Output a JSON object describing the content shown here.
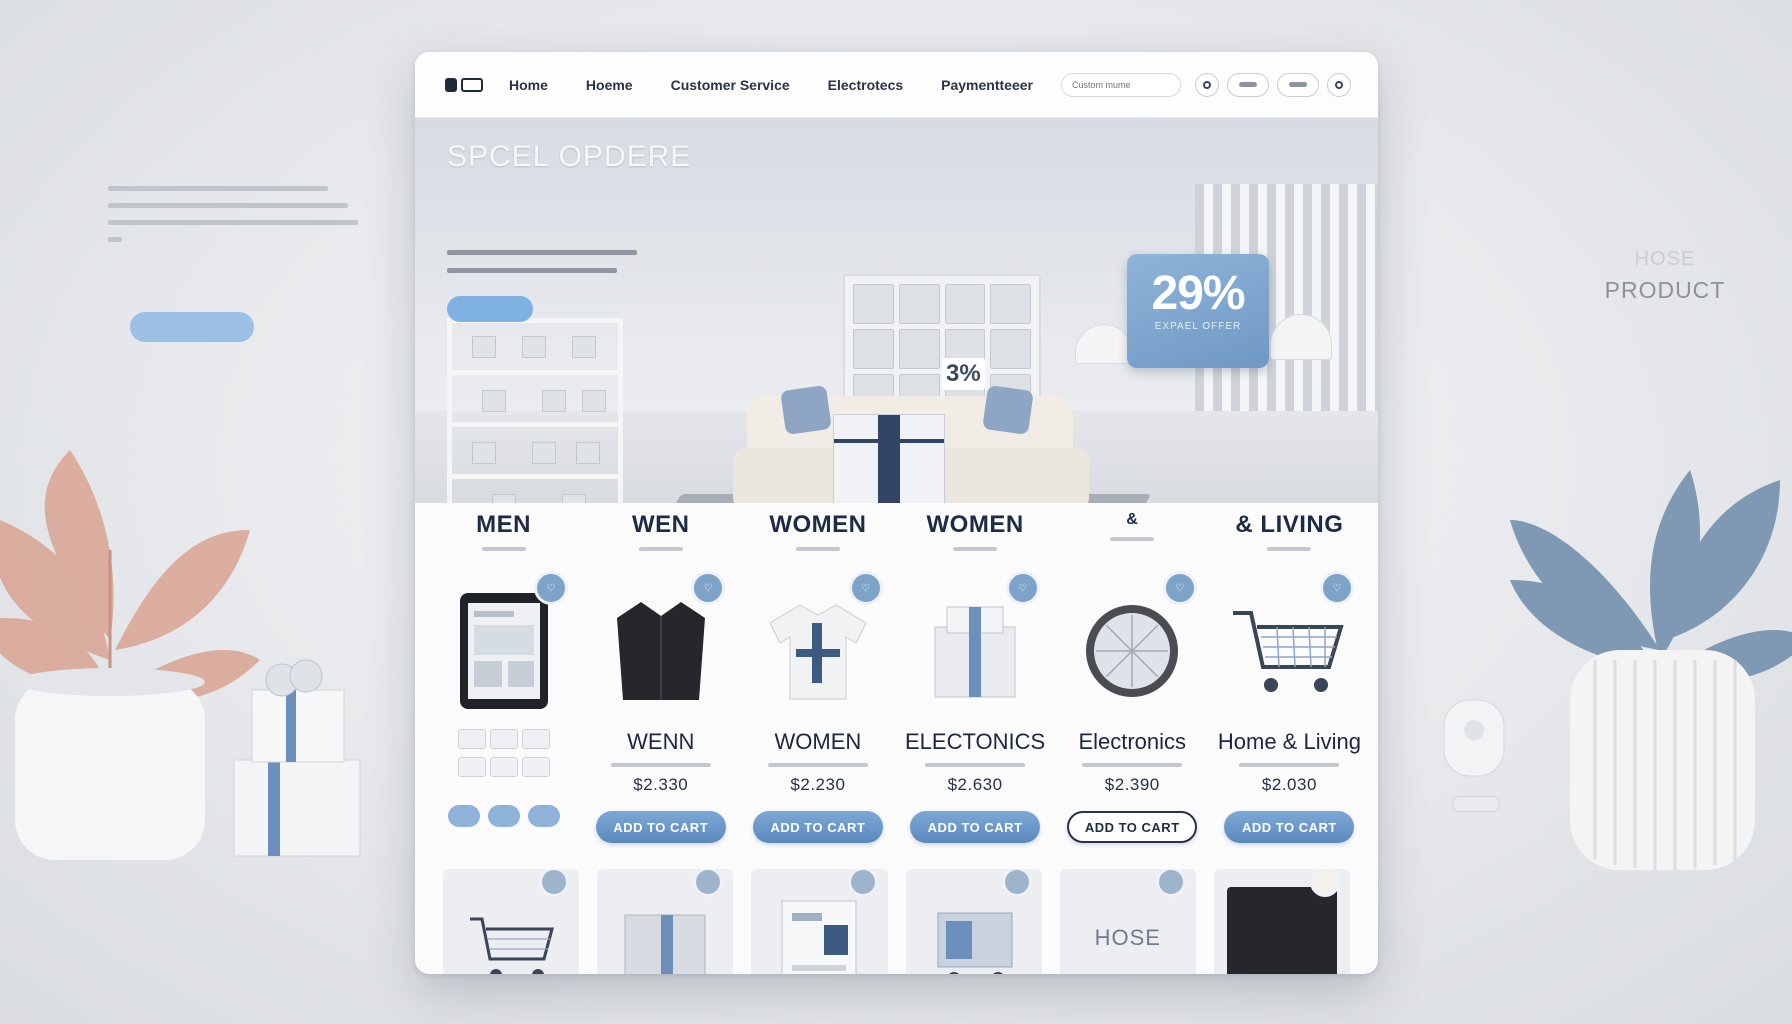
{
  "backdrop": {
    "left_button": "",
    "right_title_faint": "HOSE",
    "right_title": "PRODUCT"
  },
  "nav": {
    "links": [
      "Home",
      "Hoeme",
      "Customer Service",
      "Electrotecs",
      "Paymentteeer"
    ],
    "search_placeholder": "Custom mume"
  },
  "hero": {
    "title": "SPCEL OPDERE",
    "button_label": "",
    "board_label": "3%",
    "badge_percent": "29%",
    "badge_caption": "EXPAEL OFFER"
  },
  "categories": [
    "MEN",
    "WEN",
    "WOMEN",
    "WOMEN",
    "&",
    "& LIVING"
  ],
  "products": [
    {
      "name": "",
      "price": "",
      "cart_label": ""
    },
    {
      "name": "WENN",
      "price": "$2.330",
      "cart_label": "ADD TO CART"
    },
    {
      "name": "WOMEN",
      "price": "$2.230",
      "cart_label": "ADD TO CART"
    },
    {
      "name": "ELECTONICS",
      "price": "$2.630",
      "cart_label": "ADD TO CART"
    },
    {
      "name": "Electronics",
      "price": "$2.390",
      "cart_label": "ADD TO CART"
    },
    {
      "name": "Home & Living",
      "price": "$2.030",
      "cart_label": "ADD TO CART"
    }
  ],
  "tiles": [
    "",
    "",
    "",
    "",
    "HOSE",
    ""
  ],
  "colors": {
    "accent": "#6d98c6",
    "navy": "#1e2b44",
    "window": "#fbfbfc",
    "backdrop": "#e7e9ec"
  }
}
